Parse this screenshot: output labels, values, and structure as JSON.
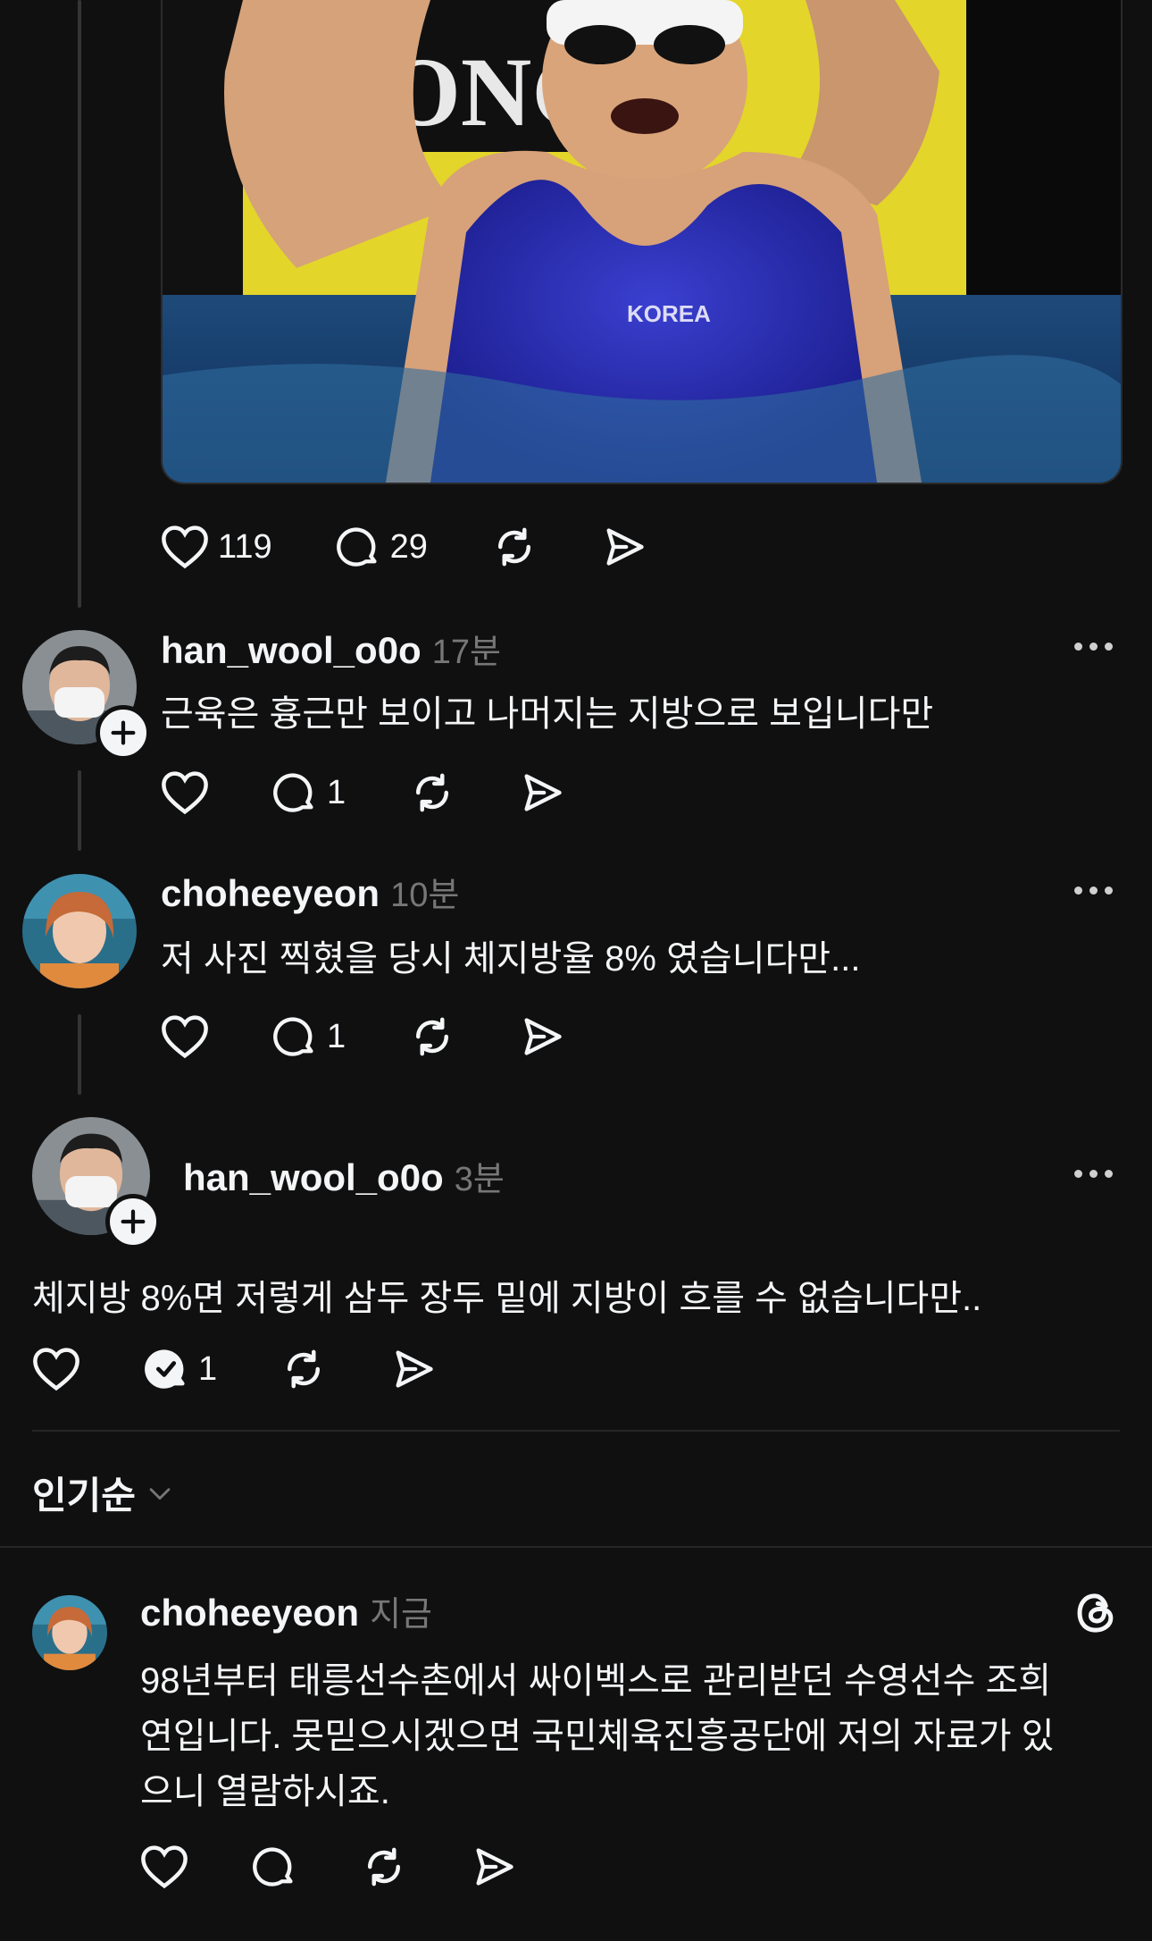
{
  "post": {
    "image_alt": "swimmer in blue KOREA swimsuit at pool",
    "image_banner_text": "LONGI",
    "swimsuit_text": "KOREA",
    "likes": "119",
    "replies": "29"
  },
  "replies": [
    {
      "username": "han_wool_o0o",
      "time": "17분",
      "text": "근육은 흉근만 보이고 나머지는 지방으로 보입니다만",
      "reply_count": "1"
    },
    {
      "username": "choheeyeon",
      "time": "10분",
      "text": "저 사진 찍혔을 당시 체지방율 8% 였습니다만...",
      "reply_count": "1"
    },
    {
      "username": "han_wool_o0o",
      "time": "3분",
      "text": "체지방 8%면 저렇게 삼두 장두 밑에 지방이 흐를 수 없습니다만..",
      "reply_count": "1"
    }
  ],
  "sort": {
    "label": "인기순"
  },
  "bottom_post": {
    "username": "choheeyeon",
    "time": "지금",
    "lines": [
      "98년부터 태릉선수촌에서 싸이벡스로 관리받던 수영선수 조희",
      "연입니다. 못믿으시겠으면 국민체육진흥공단에 저의 자료가 있",
      "으니 열람하시죠."
    ]
  },
  "icons": [
    "heart-icon",
    "comment-icon",
    "repost-icon",
    "share-icon",
    "more-icon",
    "plus-icon",
    "threads-logo-icon",
    "chevron-down-icon"
  ]
}
